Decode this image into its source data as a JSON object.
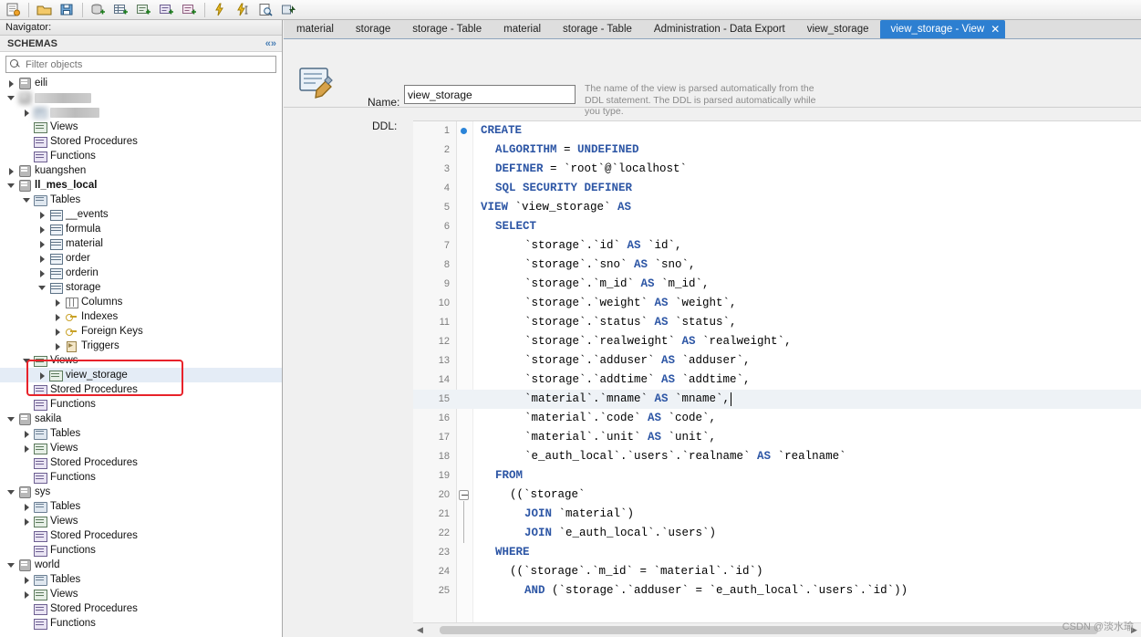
{
  "toolbar": {
    "buttons": [
      {
        "name": "new-sql-tab-icon",
        "glyph": "sql-file"
      },
      {
        "name": "open-sql-script-icon",
        "glyph": "folder-open"
      },
      {
        "name": "save-script-icon",
        "glyph": "floppy"
      },
      {
        "name": "new-schema-icon",
        "glyph": "db-plus"
      },
      {
        "name": "new-table-icon",
        "glyph": "table-plus"
      },
      {
        "name": "new-view-icon",
        "glyph": "view-plus"
      },
      {
        "name": "new-procedure-icon",
        "glyph": "proc-plus"
      },
      {
        "name": "new-function-icon",
        "glyph": "func-plus"
      },
      {
        "name": "execute-statement-icon",
        "glyph": "lightning"
      },
      {
        "name": "execute-current-statement-icon",
        "glyph": "lightning-cursor"
      },
      {
        "name": "explain-query-icon",
        "glyph": "magnifier-doc"
      },
      {
        "name": "commit-icon",
        "glyph": "commit"
      }
    ]
  },
  "navigator": {
    "title": "Navigator:",
    "section_label": "SCHEMAS",
    "collapse_icon": "double-chevron-icon",
    "filter": {
      "placeholder": "Filter objects",
      "value": "",
      "icon": "search-icon"
    },
    "tree": [
      {
        "depth": 0,
        "arrow": "closed",
        "icon": "db",
        "label": "eili",
        "blurred": false
      },
      {
        "depth": 0,
        "arrow": "open",
        "icon": "db",
        "label": "",
        "blurred": true,
        "blob_w": 62
      },
      {
        "depth": 1,
        "arrow": "closed",
        "icon": "grp",
        "label": "",
        "blurred": true,
        "blob_w": 54
      },
      {
        "depth": 1,
        "arrow": "none",
        "icon": "view",
        "label": "Views",
        "blurred": false
      },
      {
        "depth": 1,
        "arrow": "none",
        "icon": "proc",
        "label": "Stored Procedures",
        "blurred": false
      },
      {
        "depth": 1,
        "arrow": "none",
        "icon": "proc",
        "label": "Functions",
        "blurred": false
      },
      {
        "depth": 0,
        "arrow": "closed",
        "icon": "db",
        "label": "kuangshen",
        "blurred": false
      },
      {
        "depth": 0,
        "arrow": "open",
        "icon": "db",
        "label": "ll_mes_local",
        "blurred": false,
        "bold": true
      },
      {
        "depth": 1,
        "arrow": "open",
        "icon": "grp",
        "label": "Tables",
        "blurred": false
      },
      {
        "depth": 2,
        "arrow": "closed",
        "icon": "tbl",
        "label": "__events",
        "blurred": false
      },
      {
        "depth": 2,
        "arrow": "closed",
        "icon": "tbl",
        "label": "formula",
        "blurred": false
      },
      {
        "depth": 2,
        "arrow": "closed",
        "icon": "tbl",
        "label": "material",
        "blurred": false
      },
      {
        "depth": 2,
        "arrow": "closed",
        "icon": "tbl",
        "label": "order",
        "blurred": false
      },
      {
        "depth": 2,
        "arrow": "closed",
        "icon": "tbl",
        "label": "orderin",
        "blurred": false
      },
      {
        "depth": 2,
        "arrow": "open",
        "icon": "tbl",
        "label": "storage",
        "blurred": false
      },
      {
        "depth": 3,
        "arrow": "closed",
        "icon": "col",
        "label": "Columns",
        "blurred": false
      },
      {
        "depth": 3,
        "arrow": "closed",
        "icon": "key",
        "label": "Indexes",
        "blurred": false
      },
      {
        "depth": 3,
        "arrow": "closed",
        "icon": "key",
        "label": "Foreign Keys",
        "blurred": false
      },
      {
        "depth": 3,
        "arrow": "closed",
        "icon": "trg",
        "label": "Triggers",
        "blurred": false
      },
      {
        "depth": 1,
        "arrow": "open",
        "icon": "view",
        "label": "Views",
        "blurred": false,
        "highlight_group": true
      },
      {
        "depth": 2,
        "arrow": "closed",
        "icon": "view",
        "label": "view_storage",
        "blurred": false,
        "selected": true
      },
      {
        "depth": 1,
        "arrow": "none",
        "icon": "proc",
        "label": "Stored Procedures",
        "blurred": false
      },
      {
        "depth": 1,
        "arrow": "none",
        "icon": "proc",
        "label": "Functions",
        "blurred": false
      },
      {
        "depth": 0,
        "arrow": "open",
        "icon": "db",
        "label": "sakila",
        "blurred": false
      },
      {
        "depth": 1,
        "arrow": "closed",
        "icon": "grp",
        "label": "Tables",
        "blurred": false
      },
      {
        "depth": 1,
        "arrow": "closed",
        "icon": "view",
        "label": "Views",
        "blurred": false
      },
      {
        "depth": 1,
        "arrow": "none",
        "icon": "proc",
        "label": "Stored Procedures",
        "blurred": false
      },
      {
        "depth": 1,
        "arrow": "none",
        "icon": "proc",
        "label": "Functions",
        "blurred": false
      },
      {
        "depth": 0,
        "arrow": "open",
        "icon": "db",
        "label": "sys",
        "blurred": false
      },
      {
        "depth": 1,
        "arrow": "closed",
        "icon": "grp",
        "label": "Tables",
        "blurred": false
      },
      {
        "depth": 1,
        "arrow": "closed",
        "icon": "view",
        "label": "Views",
        "blurred": false
      },
      {
        "depth": 1,
        "arrow": "none",
        "icon": "proc",
        "label": "Stored Procedures",
        "blurred": false
      },
      {
        "depth": 1,
        "arrow": "none",
        "icon": "proc",
        "label": "Functions",
        "blurred": false
      },
      {
        "depth": 0,
        "arrow": "open",
        "icon": "db",
        "label": "world",
        "blurred": false
      },
      {
        "depth": 1,
        "arrow": "closed",
        "icon": "grp",
        "label": "Tables",
        "blurred": false
      },
      {
        "depth": 1,
        "arrow": "closed",
        "icon": "view",
        "label": "Views",
        "blurred": false
      },
      {
        "depth": 1,
        "arrow": "none",
        "icon": "proc",
        "label": "Stored Procedures",
        "blurred": false
      },
      {
        "depth": 1,
        "arrow": "none",
        "icon": "proc",
        "label": "Functions",
        "blurred": false
      }
    ]
  },
  "tabs": [
    {
      "label": "material",
      "active": false,
      "closable": false
    },
    {
      "label": "storage",
      "active": false,
      "closable": false
    },
    {
      "label": "storage - Table",
      "active": false,
      "closable": false
    },
    {
      "label": "material",
      "active": false,
      "closable": false
    },
    {
      "label": "storage - Table",
      "active": false,
      "closable": false
    },
    {
      "label": "Administration - Data Export",
      "active": false,
      "closable": false
    },
    {
      "label": "view_storage",
      "active": false,
      "closable": false
    },
    {
      "label": "view_storage - View",
      "active": true,
      "closable": true,
      "close_icon": "close-icon"
    }
  ],
  "editor": {
    "object_icon": "view-object-icon",
    "name_label": "Name:",
    "name_value": "view_storage",
    "ddl_label": "DDL:",
    "hint": "The name of the view is parsed automatically from the DDL statement. The DDL is parsed automatically while you type.",
    "ddl_toolbar": [
      {
        "name": "open-file-icon",
        "glyph": "folder-open"
      },
      {
        "name": "save-file-icon",
        "glyph": "floppy"
      },
      {
        "name": "beautify-sql-icon",
        "glyph": "brush"
      },
      {
        "name": "find-icon",
        "glyph": "magnifier"
      },
      {
        "name": "toggle-invisible-chars-icon",
        "glyph": "pilcrow"
      },
      {
        "name": "wrap-lines-icon",
        "glyph": "wrap"
      }
    ],
    "accent_color": "#2d7fd1",
    "keyword_color": "#2d56a5",
    "string_color": "#0a7d0a",
    "code": [
      {
        "n": 1,
        "indent": 0,
        "breakpoint": true,
        "tokens": [
          {
            "t": "CREATE",
            "c": "kw"
          }
        ]
      },
      {
        "n": 2,
        "indent": 1,
        "tokens": [
          {
            "t": "ALGORITHM",
            "c": "kw"
          },
          {
            "t": " = ",
            "c": "p"
          },
          {
            "t": "UNDEFINED",
            "c": "kw"
          }
        ]
      },
      {
        "n": 3,
        "indent": 1,
        "tokens": [
          {
            "t": "DEFINER",
            "c": "kw"
          },
          {
            "t": " = ",
            "c": "p"
          },
          {
            "t": "`root`@`localhost`",
            "c": "bt"
          }
        ]
      },
      {
        "n": 4,
        "indent": 1,
        "tokens": [
          {
            "t": "SQL SECURITY DEFINER",
            "c": "kw"
          }
        ]
      },
      {
        "n": 5,
        "indent": 0,
        "tokens": [
          {
            "t": "VIEW",
            "c": "kw"
          },
          {
            "t": " `view_storage` ",
            "c": "bt"
          },
          {
            "t": "AS",
            "c": "kw"
          }
        ]
      },
      {
        "n": 6,
        "indent": 1,
        "tokens": [
          {
            "t": "SELECT",
            "c": "kw"
          }
        ]
      },
      {
        "n": 7,
        "indent": 3,
        "tokens": [
          {
            "t": "`storage`.`id` ",
            "c": "bt"
          },
          {
            "t": "AS",
            "c": "kw"
          },
          {
            "t": " `id`,",
            "c": "bt"
          }
        ]
      },
      {
        "n": 8,
        "indent": 3,
        "tokens": [
          {
            "t": "`storage`.`sno` ",
            "c": "bt"
          },
          {
            "t": "AS",
            "c": "kw"
          },
          {
            "t": " `sno`,",
            "c": "bt"
          }
        ]
      },
      {
        "n": 9,
        "indent": 3,
        "tokens": [
          {
            "t": "`storage`.`m_id` ",
            "c": "bt"
          },
          {
            "t": "AS",
            "c": "kw"
          },
          {
            "t": " `m_id`,",
            "c": "bt"
          }
        ]
      },
      {
        "n": 10,
        "indent": 3,
        "tokens": [
          {
            "t": "`storage`.`weight` ",
            "c": "bt"
          },
          {
            "t": "AS",
            "c": "kw"
          },
          {
            "t": " `weight`,",
            "c": "bt"
          }
        ]
      },
      {
        "n": 11,
        "indent": 3,
        "tokens": [
          {
            "t": "`storage`.`status` ",
            "c": "bt"
          },
          {
            "t": "AS",
            "c": "kw"
          },
          {
            "t": " `status`,",
            "c": "bt"
          }
        ]
      },
      {
        "n": 12,
        "indent": 3,
        "tokens": [
          {
            "t": "`storage`.`realweight` ",
            "c": "bt"
          },
          {
            "t": "AS",
            "c": "kw"
          },
          {
            "t": " `realweight`,",
            "c": "bt"
          }
        ]
      },
      {
        "n": 13,
        "indent": 3,
        "tokens": [
          {
            "t": "`storage`.`adduser` ",
            "c": "bt"
          },
          {
            "t": "AS",
            "c": "kw"
          },
          {
            "t": " `adduser`,",
            "c": "bt"
          }
        ]
      },
      {
        "n": 14,
        "indent": 3,
        "tokens": [
          {
            "t": "`storage`.`addtime` ",
            "c": "bt"
          },
          {
            "t": "AS",
            "c": "kw"
          },
          {
            "t": " `addtime`,",
            "c": "bt"
          }
        ]
      },
      {
        "n": 15,
        "indent": 3,
        "highlight": true,
        "caret": true,
        "tokens": [
          {
            "t": "`material`.`mname` ",
            "c": "bt"
          },
          {
            "t": "AS",
            "c": "kw"
          },
          {
            "t": " `mname`,",
            "c": "bt"
          }
        ]
      },
      {
        "n": 16,
        "indent": 3,
        "tokens": [
          {
            "t": "`material`.`code` ",
            "c": "bt"
          },
          {
            "t": "AS",
            "c": "kw"
          },
          {
            "t": " `code`,",
            "c": "bt"
          }
        ]
      },
      {
        "n": 17,
        "indent": 3,
        "tokens": [
          {
            "t": "`material`.`unit` ",
            "c": "bt"
          },
          {
            "t": "AS",
            "c": "kw"
          },
          {
            "t": " `unit`,",
            "c": "bt"
          }
        ]
      },
      {
        "n": 18,
        "indent": 3,
        "tokens": [
          {
            "t": "`e_auth_local`.`users`.`realname` ",
            "c": "bt"
          },
          {
            "t": "AS",
            "c": "kw"
          },
          {
            "t": " `realname`",
            "c": "bt"
          }
        ]
      },
      {
        "n": 19,
        "indent": 1,
        "tokens": [
          {
            "t": "FROM",
            "c": "kw"
          }
        ]
      },
      {
        "n": 20,
        "indent": 2,
        "fold": true,
        "tokens": [
          {
            "t": "((`storage`",
            "c": "bt"
          }
        ]
      },
      {
        "n": 21,
        "indent": 3,
        "tokens": [
          {
            "t": "JOIN",
            "c": "kw"
          },
          {
            "t": " `material`)",
            "c": "bt"
          }
        ]
      },
      {
        "n": 22,
        "indent": 3,
        "tokens": [
          {
            "t": "JOIN",
            "c": "kw"
          },
          {
            "t": " `e_auth_local`.`users`)",
            "c": "bt"
          }
        ]
      },
      {
        "n": 23,
        "indent": 1,
        "tokens": [
          {
            "t": "WHERE",
            "c": "kw"
          }
        ]
      },
      {
        "n": 24,
        "indent": 2,
        "tokens": [
          {
            "t": "((`storage`.`m_id` = `material`.`id`)",
            "c": "bt"
          }
        ]
      },
      {
        "n": 25,
        "indent": 3,
        "tokens": [
          {
            "t": "AND",
            "c": "kw"
          },
          {
            "t": " (`storage`.`adduser` = `e_auth_local`.`users`.`id`))",
            "c": "bt"
          }
        ]
      }
    ]
  },
  "scrollbar": {
    "left_arrow": "chevron-left-icon",
    "right_arrow": "chevron-right-icon"
  },
  "watermark": "CSDN @淡水瑜"
}
